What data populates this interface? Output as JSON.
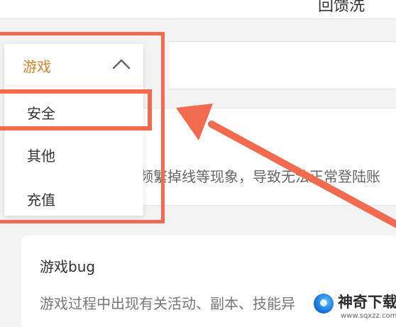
{
  "top": {
    "title_partial": "回馈洗"
  },
  "dropdown": {
    "selected": "游戏",
    "options": [
      {
        "label": "安全"
      },
      {
        "label": "其他"
      },
      {
        "label": "充值"
      }
    ]
  },
  "background": {
    "card1_text": "频繁掉线等现象，导致无法正常登陆账",
    "card2": {
      "title": "游戏bug",
      "desc": "游戏过程中出现有关活动、副本、技能异"
    }
  },
  "watermark": {
    "name": "神奇下载",
    "url": "www.sqxzz.com"
  },
  "colors": {
    "highlight": "#f26b4f",
    "selected_text": "#d9822b"
  }
}
